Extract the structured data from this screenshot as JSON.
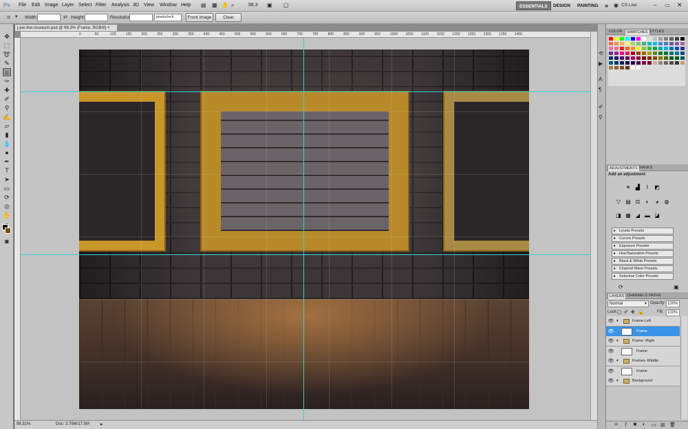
{
  "app": {
    "logo": "Ps"
  },
  "menu": [
    "File",
    "Edit",
    "Image",
    "Layer",
    "Select",
    "Filter",
    "Analysis",
    "3D",
    "View",
    "Window",
    "Help"
  ],
  "zoom_field": "98.3",
  "workspaces": {
    "essentials": "ESSENTIALS",
    "design": "DESIGN",
    "painting": "PAINTING",
    "more": "»",
    "cslive": "CS Live"
  },
  "options": {
    "width_label": "Width:",
    "height_label": "Height:",
    "resolution_label": "Resolution:",
    "resolution_unit": "pixels/inch",
    "front_image": "Front Image",
    "clear": "Clear"
  },
  "document": {
    "tab_title": "j-joe-live-museum.psd @ 98.3% (Frame, RGB/8)",
    "zoom": "98.31%",
    "doc_info": "Doc: 3.76M/17.5M"
  },
  "ruler": [
    "0",
    "50",
    "100",
    "150",
    "200",
    "250",
    "300",
    "350",
    "400",
    "450",
    "500",
    "550",
    "600",
    "650",
    "700",
    "750",
    "800",
    "850",
    "900",
    "950",
    "1000",
    "1050",
    "1100",
    "1150",
    "1200",
    "1250",
    "1300",
    "1350",
    "1400"
  ],
  "panels": {
    "color_tabs": [
      "COLOR",
      "SWATCHES",
      "STYLES"
    ],
    "swatch_colors": [
      "#ff0000",
      "#ffff00",
      "#00ff00",
      "#00ffff",
      "#0000ff",
      "#ff00ff",
      "#ffffff",
      "#e0e0e0",
      "#c0c0c0",
      "#a0a0a0",
      "#808080",
      "#606060",
      "#404040",
      "#000000",
      "#f26c4f",
      "#f68e56",
      "#fbaf5c",
      "#fff467",
      "#acd372",
      "#7cc576",
      "#3bb878",
      "#1abbb4",
      "#00bff3",
      "#438ccb",
      "#5574b9",
      "#605ca8",
      "#855fa8",
      "#a763a8",
      "#f06ea9",
      "#f26d7d",
      "#ed1c24",
      "#f26522",
      "#f7941d",
      "#fff200",
      "#8dc63f",
      "#39b54a",
      "#00a651",
      "#00a99d",
      "#00aeef",
      "#0072bc",
      "#0054a6",
      "#2e3192",
      "#662d91",
      "#92278f",
      "#ec008c",
      "#ed145b",
      "#9e0b0f",
      "#a0410d",
      "#a36209",
      "#aba000",
      "#598527",
      "#1a7b30",
      "#007236",
      "#00746b",
      "#0076a3",
      "#004b80",
      "#003471",
      "#1b1464",
      "#440e62",
      "#630460",
      "#9e005d",
      "#9e0039",
      "#790000",
      "#7b2e00",
      "#7d4900",
      "#827b00",
      "#406618",
      "#005e20",
      "#005826",
      "#005952",
      "#005b7f",
      "#003663",
      "#002157",
      "#0d004c",
      "#32004b",
      "#4b0049",
      "#7b0046",
      "#7a0026",
      "#c7b299",
      "#998675",
      "#736357",
      "#534741",
      "#37302d",
      "#c69c6d",
      "#a67c52",
      "#8c6239",
      "#754c24",
      "#603913",
      "#ffffff",
      "#ffffff"
    ],
    "adjust_tabs": [
      "ADJUSTMENTS",
      "MASKS"
    ],
    "adjust_title": "Add an adjustment",
    "presets": [
      "Levels Presets",
      "Curves Presets",
      "Exposure Presets",
      "Hue/Saturation Presets",
      "Black & White Presets",
      "Channel Mixer Presets",
      "Selective Color Presets"
    ],
    "layer_tabs": [
      "LAYERS",
      "CHANNELS",
      "PATHS"
    ],
    "blend_mode": "Normal",
    "opacity_label": "Opacity:",
    "opacity": "100%",
    "lock_label": "Lock:",
    "fill_label": "Fill:",
    "fill": "100%",
    "layers": [
      {
        "name": "Frame-Left",
        "type": "group"
      },
      {
        "name": "Frame",
        "type": "layer",
        "selected": true
      },
      {
        "name": "Frame -Right",
        "type": "group"
      },
      {
        "name": "Frame",
        "type": "layer"
      },
      {
        "name": "Frames -Middle",
        "type": "group"
      },
      {
        "name": "Frame",
        "type": "layer"
      },
      {
        "name": "Background",
        "type": "group"
      }
    ]
  }
}
